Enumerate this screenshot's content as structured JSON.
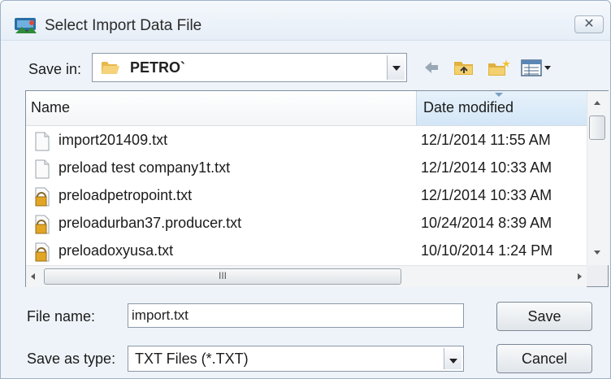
{
  "window": {
    "title": "Select Import Data File",
    "close_glyph": "✕"
  },
  "savein": {
    "label": "Save in:",
    "value": "PETRO`"
  },
  "columns": {
    "name": "Name",
    "date": "Date modified"
  },
  "files": [
    {
      "name": "import201409.txt",
      "date": "12/1/2014 11:55 AM",
      "icon": "text-file-icon"
    },
    {
      "name": "preload test company1t.txt",
      "date": "12/1/2014 10:33 AM",
      "icon": "text-file-icon"
    },
    {
      "name": "preloadpetropoint.txt",
      "date": "12/1/2014 10:33 AM",
      "icon": "locked-file-icon"
    },
    {
      "name": "preloadurban37.producer.txt",
      "date": "10/24/2014 8:39 AM",
      "icon": "locked-file-icon"
    },
    {
      "name": "preloadoxyusa.txt",
      "date": "10/10/2014 1:24 PM",
      "icon": "locked-file-icon"
    }
  ],
  "scroll": {
    "grip": "III"
  },
  "filename": {
    "label": "File name:",
    "value": "import.txt"
  },
  "savetype": {
    "label": "Save as type:",
    "value": "TXT Files (*.TXT)"
  },
  "buttons": {
    "save": "Save",
    "cancel": "Cancel"
  }
}
